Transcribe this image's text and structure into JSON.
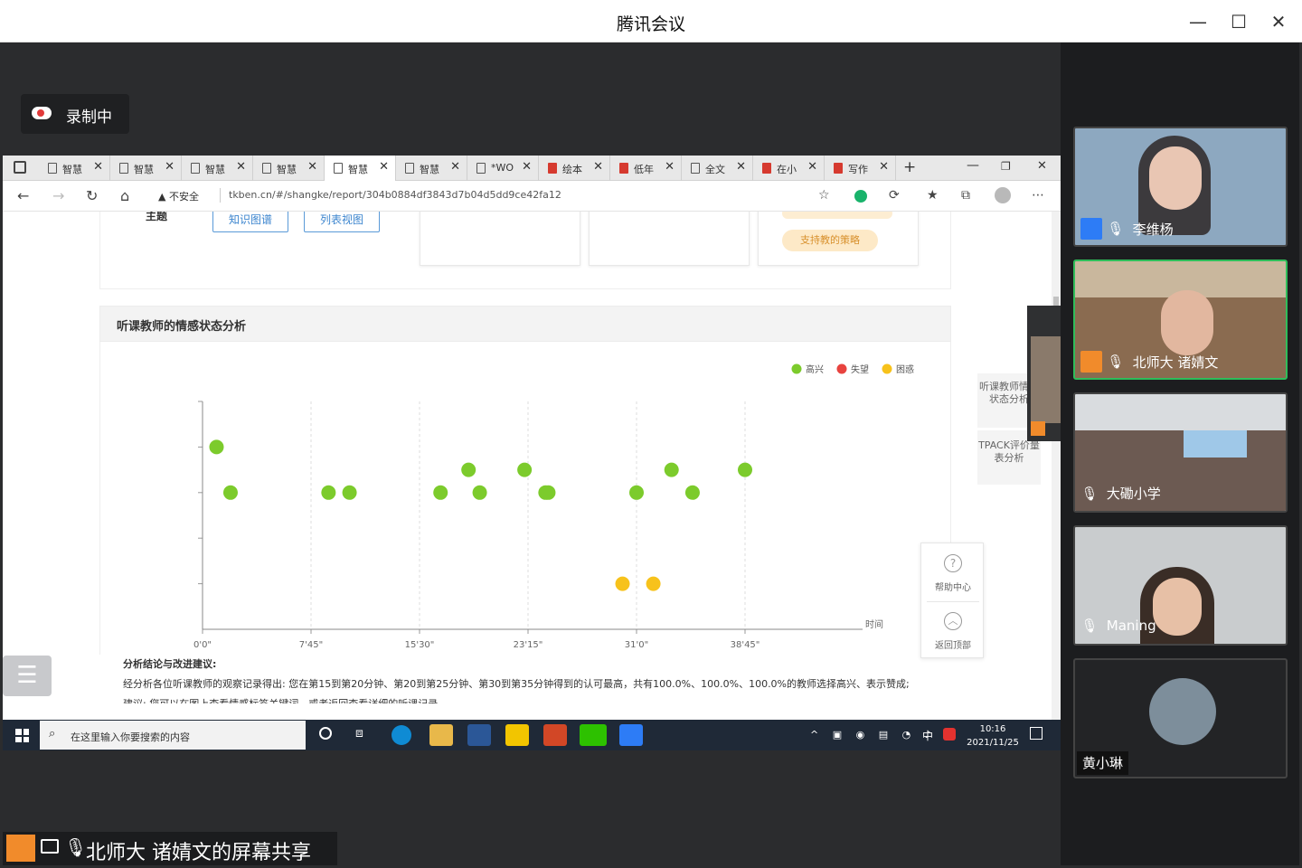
{
  "app": {
    "title": "腾讯会议"
  },
  "recording": {
    "label": "录制中"
  },
  "browser": {
    "tabs": [
      {
        "label": "智慧",
        "icon": "page-icon",
        "pdf": false
      },
      {
        "label": "智慧",
        "icon": "page-icon",
        "pdf": false
      },
      {
        "label": "智慧",
        "icon": "page-icon",
        "pdf": false
      },
      {
        "label": "智慧",
        "icon": "page-icon",
        "pdf": false
      },
      {
        "label": "智慧",
        "icon": "page-icon",
        "pdf": false,
        "active": true
      },
      {
        "label": "智慧",
        "icon": "page-icon",
        "pdf": false
      },
      {
        "label": "*WO",
        "icon": "page-icon",
        "pdf": false
      },
      {
        "label": "绘本",
        "icon": "pdf-icon",
        "pdf": true
      },
      {
        "label": "低年",
        "icon": "pdf-icon",
        "pdf": true
      },
      {
        "label": "全文",
        "icon": "doc-icon",
        "pdf": false
      },
      {
        "label": "在小",
        "icon": "pdf-icon",
        "pdf": true
      },
      {
        "label": "写作",
        "icon": "pdf-icon",
        "pdf": true
      }
    ],
    "new_tab": "+",
    "security": "不安全",
    "url": "tkben.cn/#/shangke/report/304b0884df3843d7b04d5dd9ce42fa12"
  },
  "page": {
    "top_fragment": "主题",
    "btn_knowledge": "知识图谱",
    "btn_list": "列表视图",
    "pill_strategy": "支持教的策略",
    "section_title": "听课教师的情感状态分析",
    "side_tabs": [
      "听课教师情感状态分析",
      "TPACK评价量表分析"
    ],
    "help": "帮助中心",
    "back_top": "返回顶部",
    "conclusion_title": "分析结论与改进建议:",
    "conclusion_text": "经分析各位听课教师的观察记录得出:  您在第15到第20分钟、第20到第25分钟、第30到第35分钟得到的认可最高，共有100.0%、100.0%、100.0%的教师选择高兴、表示赞成;",
    "conclusion_cut": "建议: 您可以在图上查看情感标签关键词，或者返回查看详细的听课记录"
  },
  "chart_data": {
    "type": "scatter",
    "xlabel": "时间",
    "x_ticks": [
      "0'0\"",
      "7'45\"",
      "15'30\"",
      "23'15\"",
      "31'0\"",
      "38'45\""
    ],
    "xlim": [
      0,
      46.5
    ],
    "ylim": [
      0,
      5
    ],
    "legend_position": "top-right",
    "series": [
      {
        "name": "高兴",
        "color": "#7ccb2c",
        "points": [
          [
            1,
            4
          ],
          [
            2,
            3
          ],
          [
            9,
            3
          ],
          [
            10.5,
            3
          ],
          [
            17,
            3
          ],
          [
            19,
            3.5
          ],
          [
            19.8,
            3
          ],
          [
            23,
            3.5
          ],
          [
            24.5,
            3
          ],
          [
            24.7,
            3
          ],
          [
            31,
            3
          ],
          [
            33.5,
            3.5
          ],
          [
            35,
            3
          ],
          [
            38.75,
            3.5
          ]
        ]
      },
      {
        "name": "失望",
        "color": "#e8433f",
        "points": []
      },
      {
        "name": "困惑",
        "color": "#f7c21b",
        "points": [
          [
            30,
            1
          ],
          [
            32.2,
            1
          ]
        ]
      }
    ]
  },
  "taskbar": {
    "search_placeholder": "在这里输入你要搜索的内容",
    "time": "10:16",
    "date": "2021/11/25",
    "ime": "中"
  },
  "share": {
    "label": "北师大 诸婧文的屏幕共享"
  },
  "participants": [
    {
      "name": "李维杨",
      "avatar_color": "#2d7cf6",
      "muted": true,
      "speaking": false
    },
    {
      "name": "北师大 诸婧文",
      "avatar_color": "#f18b2b",
      "muted": false,
      "speaking": true
    },
    {
      "name": "大磡小学",
      "avatar_color": "",
      "muted": true,
      "speaking": false
    },
    {
      "name": "Maning",
      "avatar_color": "",
      "muted": true,
      "speaking": false
    },
    {
      "name": "黄小琳",
      "avatar_color": "",
      "muted": false,
      "speaking": false
    }
  ]
}
